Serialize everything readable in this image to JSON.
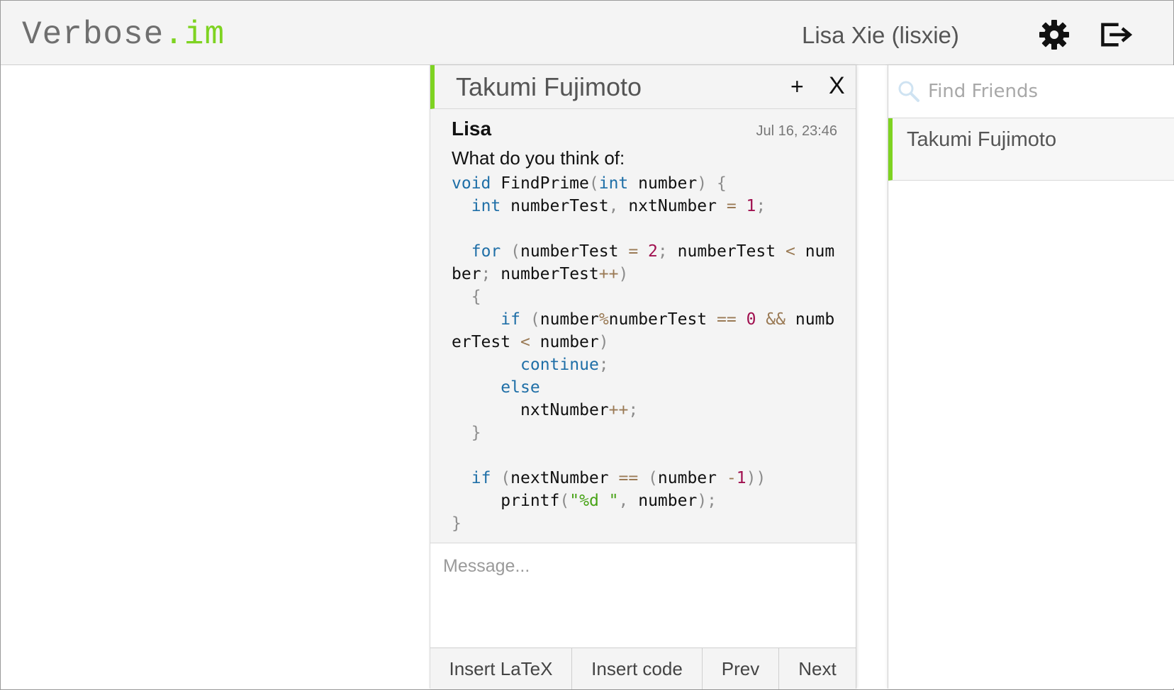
{
  "app": {
    "logo_name": "Verbose",
    "logo_dot": ".",
    "logo_tld": "im",
    "accent_color": "#7ed321"
  },
  "header": {
    "user_display": "Lisa Xie (lisxie)",
    "settings_icon": "gear-icon",
    "logout_icon": "logout-icon"
  },
  "chat": {
    "title": "Takumi Fujimoto",
    "add_label": "+",
    "close_label": "X",
    "message": {
      "sender": "Lisa",
      "timestamp": "Jul 16, 23:46",
      "text": "What do you think of:",
      "code": "void FindPrime(int number) {\n  int numberTest, nxtNumber = 1;\n\n  for (numberTest = 2; numberTest < number; numberTest++)\n  {\n     if (number%numberTest == 0 && numberTest < number)\n       continue;\n     else\n       nxtNumber++;\n  }\n\n  if (nextNumber == (number -1))\n     printf(\"%d \", number);\n}"
    },
    "compose_placeholder": "Message...",
    "toolbar": {
      "insert_latex": "Insert LaTeX",
      "insert_code": "Insert code",
      "prev": "Prev",
      "next": "Next"
    }
  },
  "friends": {
    "search_placeholder": "Find Friends",
    "items": [
      {
        "name": "Takumi Fujimoto"
      }
    ]
  }
}
